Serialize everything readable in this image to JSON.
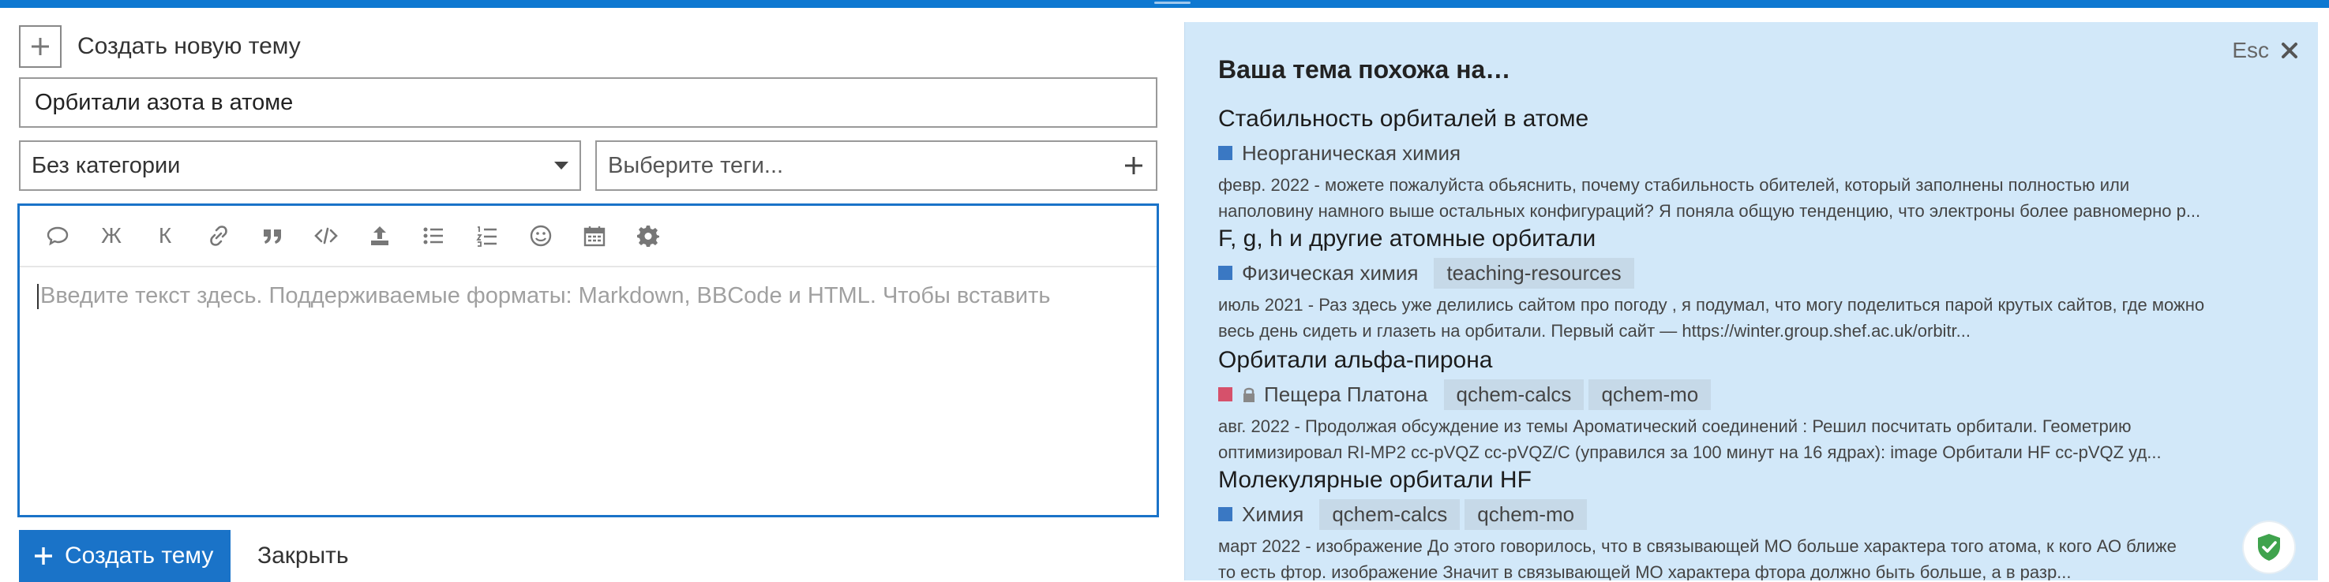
{
  "composer": {
    "header_label": "Создать новую тему",
    "title_value": "Орбитали азота в атоме",
    "category_value": "Без категории",
    "tags_placeholder": "Выберите теги...",
    "toolbar": {
      "bold_label": "Ж",
      "italic_label": "К"
    },
    "editor_placeholder": "Введите текст здесь. Поддерживаемые форматы: Markdown, BBCode и HTML. Чтобы вставить",
    "create_label": "Создать тему",
    "close_label": "Закрыть"
  },
  "similar": {
    "title": "Ваша тема похожа на…",
    "esc_label": "Esc",
    "topics": [
      {
        "title": "Стабильность орбиталей в атоме",
        "category": "Неорганическая химия",
        "category_color": "#3a78c3",
        "tags": [],
        "excerpt_line1": "февр. 2022 - можете пожалуйста обьяснить, почему стабильность обителей, который заполнены полностью или",
        "excerpt_line2": "наполовину намного выше остальных конфигураций? Я поняла общую тенденцию, что электроны более равномерно р..."
      },
      {
        "title": "F, g, h и другие атомные орбитали",
        "category": "Физическая химия",
        "category_color": "#3a78c3",
        "tags": [
          "teaching-resources"
        ],
        "excerpt_line1": "июль 2021 - Раз здесь уже делились сайтом про погоду , я подумал, что могу поделиться парой крутых сайтов, где можно",
        "excerpt_line2": "весь день сидеть и глазеть на орбитали. Первый сайт — https://winter.group.shef.ac.uk/orbitr..."
      },
      {
        "title": "Орбитали альфа-пирона",
        "category": "Пещера Платона",
        "category_color": "#d6516b",
        "locked": true,
        "tags": [
          "qchem-calcs",
          "qchem-mo"
        ],
        "excerpt_line1": "авг. 2022 - Продолжая обсуждение из темы Ароматический соединений : Решил посчитать орбитали. Геометрию",
        "excerpt_line2": "оптимизировал RI-MP2 cc-pVQZ cc-pVQZ/C (управился за 100 минут на 16 ядрах): image Орбитали HF cc-pVQZ уд..."
      },
      {
        "title": "Молекулярные орбитали HF",
        "category": "Химия",
        "category_color": "#3a78c3",
        "tags": [
          "qchem-calcs",
          "qchem-mo"
        ],
        "excerpt_line1": "март 2022 - изображение До этого говорилось, что в связывающей МО больше характера того атома, к кого АО ближе",
        "excerpt_line2": "то есть фтор. изображение Значит в связывающей МО характера фтора должно быть больше, а в разр..."
      }
    ]
  }
}
